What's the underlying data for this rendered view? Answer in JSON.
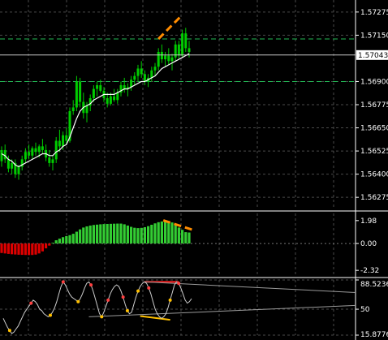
{
  "colors": {
    "background": "#000000",
    "grid": "#4a4a4a",
    "axis": "#ffffff",
    "candle": "#00cc00",
    "ma_line": "#ffffff",
    "level_line": "#22bb55",
    "current_line": "#c8c8c8",
    "trend_annotation": "#ff8c00",
    "osc_positive": "#33cc33",
    "osc_negative": "#dd0000",
    "rsi_line": "#cccccc",
    "rsi_high_dot": "#ff4040",
    "rsi_low_dot": "#ffc000",
    "rsi_trend_high": "#ff2020",
    "rsi_trend_low": "#ffc000"
  },
  "chart_data": [
    {
      "type": "candlestick",
      "y_ticks": [
        "1.57275",
        "1.57150",
        "1.56900",
        "1.56775",
        "1.56650",
        "1.56525",
        "1.56400",
        "1.56275"
      ],
      "ylim": [
        1.5621,
        1.5734
      ],
      "current_price": "1.57043",
      "current_value": 1.57043,
      "level_lines": [
        1.5713,
        1.569
      ],
      "grid": true,
      "candles": [
        [
          1.5647,
          1.5655,
          1.5644,
          1.5653
        ],
        [
          1.5653,
          1.5656,
          1.5646,
          1.5648
        ],
        [
          1.5648,
          1.565,
          1.5641,
          1.5643
        ],
        [
          1.5643,
          1.5648,
          1.564,
          1.5646
        ],
        [
          1.5646,
          1.5648,
          1.5638,
          1.564
        ],
        [
          1.564,
          1.5645,
          1.5637,
          1.5644
        ],
        [
          1.5644,
          1.565,
          1.5642,
          1.5648
        ],
        [
          1.5648,
          1.5654,
          1.5646,
          1.5652
        ],
        [
          1.5652,
          1.5656,
          1.5648,
          1.565
        ],
        [
          1.565,
          1.5655,
          1.5648,
          1.5654
        ],
        [
          1.5654,
          1.5657,
          1.565,
          1.5652
        ],
        [
          1.5652,
          1.5656,
          1.5649,
          1.5655
        ],
        [
          1.5655,
          1.5659,
          1.5651,
          1.5653
        ],
        [
          1.5653,
          1.5656,
          1.5647,
          1.5649
        ],
        [
          1.5649,
          1.5653,
          1.5644,
          1.5646
        ],
        [
          1.5646,
          1.565,
          1.5642,
          1.5648
        ],
        [
          1.5648,
          1.566,
          1.5646,
          1.5658
        ],
        [
          1.5658,
          1.5664,
          1.5652,
          1.5655
        ],
        [
          1.5655,
          1.5663,
          1.5653,
          1.5661
        ],
        [
          1.5661,
          1.5665,
          1.5656,
          1.5658
        ],
        [
          1.5658,
          1.5676,
          1.5657,
          1.5674
        ],
        [
          1.5674,
          1.568,
          1.5672,
          1.5676
        ],
        [
          1.5676,
          1.5693,
          1.5674,
          1.569
        ],
        [
          1.569,
          1.5692,
          1.5676,
          1.5679
        ],
        [
          1.5679,
          1.5684,
          1.567,
          1.5673
        ],
        [
          1.5673,
          1.5679,
          1.5668,
          1.5677
        ],
        [
          1.5677,
          1.5683,
          1.5674,
          1.5681
        ],
        [
          1.5681,
          1.5688,
          1.5679,
          1.5686
        ],
        [
          1.5686,
          1.569,
          1.5682,
          1.5688
        ],
        [
          1.5688,
          1.5691,
          1.5684,
          1.5685
        ],
        [
          1.5685,
          1.5687,
          1.5679,
          1.5681
        ],
        [
          1.5681,
          1.5684,
          1.5676,
          1.5678
        ],
        [
          1.5678,
          1.5684,
          1.5677,
          1.5682
        ],
        [
          1.5682,
          1.5686,
          1.5679,
          1.568
        ],
        [
          1.568,
          1.5686,
          1.5678,
          1.5684
        ],
        [
          1.5684,
          1.569,
          1.5682,
          1.5688
        ],
        [
          1.5688,
          1.5692,
          1.5684,
          1.5686
        ],
        [
          1.5686,
          1.5689,
          1.5682,
          1.5687
        ],
        [
          1.5687,
          1.5693,
          1.5685,
          1.5691
        ],
        [
          1.5691,
          1.5695,
          1.5688,
          1.5693
        ],
        [
          1.5693,
          1.5699,
          1.569,
          1.5697
        ],
        [
          1.5697,
          1.5701,
          1.5692,
          1.5694
        ],
        [
          1.5694,
          1.5696,
          1.5688,
          1.569
        ],
        [
          1.569,
          1.5694,
          1.5687,
          1.5692
        ],
        [
          1.5692,
          1.5698,
          1.569,
          1.5696
        ],
        [
          1.5696,
          1.57,
          1.5693,
          1.5698
        ],
        [
          1.5698,
          1.5708,
          1.5696,
          1.5706
        ],
        [
          1.5706,
          1.571,
          1.57,
          1.5702
        ],
        [
          1.5702,
          1.5706,
          1.5698,
          1.5704
        ],
        [
          1.5704,
          1.5708,
          1.5699,
          1.5701
        ],
        [
          1.5701,
          1.5705,
          1.5696,
          1.5703
        ],
        [
          1.5703,
          1.5712,
          1.5701,
          1.571
        ],
        [
          1.571,
          1.5712,
          1.5702,
          1.5704
        ],
        [
          1.5704,
          1.5718,
          1.5703,
          1.5716
        ],
        [
          1.5716,
          1.5719,
          1.5706,
          1.5708
        ],
        [
          1.5708,
          1.5712,
          1.5703,
          1.5706
        ]
      ],
      "moving_average": [
        1.5651,
        1.565,
        1.5648,
        1.5647,
        1.5645,
        1.5644,
        1.5645,
        1.5646,
        1.5647,
        1.5648,
        1.5649,
        1.565,
        1.5651,
        1.5651,
        1.565,
        1.565,
        1.5652,
        1.5653,
        1.5655,
        1.5656,
        1.566,
        1.5665,
        1.567,
        1.5674,
        1.5676,
        1.5677,
        1.5678,
        1.568,
        1.5681,
        1.5682,
        1.5683,
        1.5683,
        1.5683,
        1.5683,
        1.5684,
        1.5685,
        1.5686,
        1.5686,
        1.5687,
        1.5688,
        1.5689,
        1.569,
        1.569,
        1.5691,
        1.5692,
        1.5693,
        1.5695,
        1.5697,
        1.5698,
        1.5699,
        1.57,
        1.5701,
        1.5702,
        1.5703,
        1.5704,
        1.5705
      ],
      "trend_annotation": {
        "from": [
          46,
          1.5713
        ],
        "to": [
          53,
          1.5726
        ]
      }
    },
    {
      "type": "bar",
      "y_ticks": [
        "1.98",
        "0.00",
        "-2.32"
      ],
      "ylim": [
        -2.8,
        2.6
      ],
      "zero_line": true,
      "values": [
        -0.82,
        -0.86,
        -0.9,
        -0.93,
        -0.95,
        -0.97,
        -0.98,
        -0.99,
        -1.0,
        -0.99,
        -0.96,
        -0.86,
        -0.68,
        -0.42,
        -0.18,
        0.06,
        0.28,
        0.42,
        0.55,
        0.64,
        0.72,
        0.84,
        1.02,
        1.22,
        1.38,
        1.48,
        1.55,
        1.6,
        1.63,
        1.66,
        1.68,
        1.69,
        1.7,
        1.71,
        1.72,
        1.72,
        1.66,
        1.55,
        1.44,
        1.36,
        1.33,
        1.35,
        1.41,
        1.5,
        1.62,
        1.74,
        1.84,
        1.9,
        1.93,
        1.9,
        1.82,
        1.62,
        1.38,
        1.18,
        0.98,
        0.95
      ],
      "trend_annotation": {
        "from": [
          51,
          2.0
        ],
        "to": [
          60,
          1.2
        ]
      }
    },
    {
      "type": "line",
      "y_ticks": [
        "88.5236",
        "50",
        "15.8776"
      ],
      "ylim": [
        15.8776,
        88.5236
      ],
      "values": [
        38,
        32,
        26,
        22,
        18,
        20,
        24,
        28,
        34,
        40,
        46,
        50,
        54,
        58,
        62,
        60,
        56,
        50,
        48,
        44,
        42,
        40,
        42,
        46,
        52,
        60,
        70,
        80,
        86,
        82,
        76,
        70,
        66,
        64,
        62,
        60,
        64,
        70,
        78,
        84,
        86,
        82,
        74,
        64,
        54,
        44,
        40,
        46,
        54,
        62,
        70,
        76,
        80,
        82,
        80,
        74,
        66,
        56,
        48,
        44,
        46,
        56,
        66,
        74,
        80,
        84,
        86,
        84,
        78,
        70,
        60,
        50,
        44,
        40,
        38,
        40,
        44,
        52,
        62,
        72,
        82,
        86,
        84,
        78,
        70,
        62,
        58,
        60,
        64
      ],
      "high_points": [
        13,
        28,
        41,
        49,
        56,
        68,
        82
      ],
      "low_points": [
        3,
        22,
        35,
        46,
        58,
        63,
        78
      ],
      "trend_lines": [
        {
          "role": "high",
          "from": [
            66,
            86
          ],
          "to": [
            82,
            86
          ]
        },
        {
          "role": "low",
          "from": [
            64,
            41
          ],
          "to": [
            78,
            36
          ]
        },
        {
          "role": "projection",
          "from": [
            66,
            86
          ],
          "to": [
            100,
            72
          ]
        },
        {
          "role": "projection",
          "from": [
            40,
            40
          ],
          "to": [
            100,
            55
          ]
        }
      ],
      "grid": true
    }
  ]
}
